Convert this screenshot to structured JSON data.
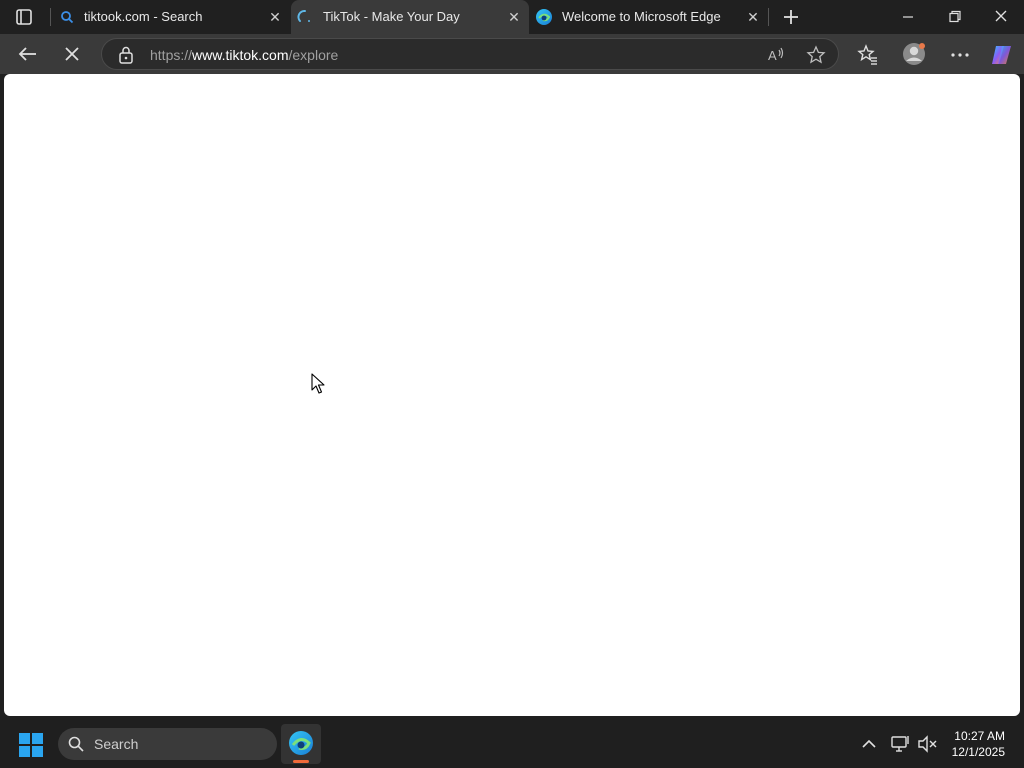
{
  "browser": {
    "tabs": [
      {
        "title": "tiktook.com - Search",
        "icon": "search-icon",
        "active": false
      },
      {
        "title": "TikTok - Make Your Day",
        "icon": "loading-spinner-icon",
        "active": true
      },
      {
        "title": "Welcome to Microsoft Edge",
        "icon": "edge-logo-icon",
        "active": false
      }
    ],
    "address": {
      "scheme": "https://",
      "host": "www.tiktok.com",
      "path": "/explore"
    }
  },
  "taskbar": {
    "search_label": "Search",
    "time": "10:27 AM",
    "date": "12/1/2025"
  },
  "colors": {
    "edge_accent": "#f06a3a",
    "windows_blue": "#0078d4"
  }
}
